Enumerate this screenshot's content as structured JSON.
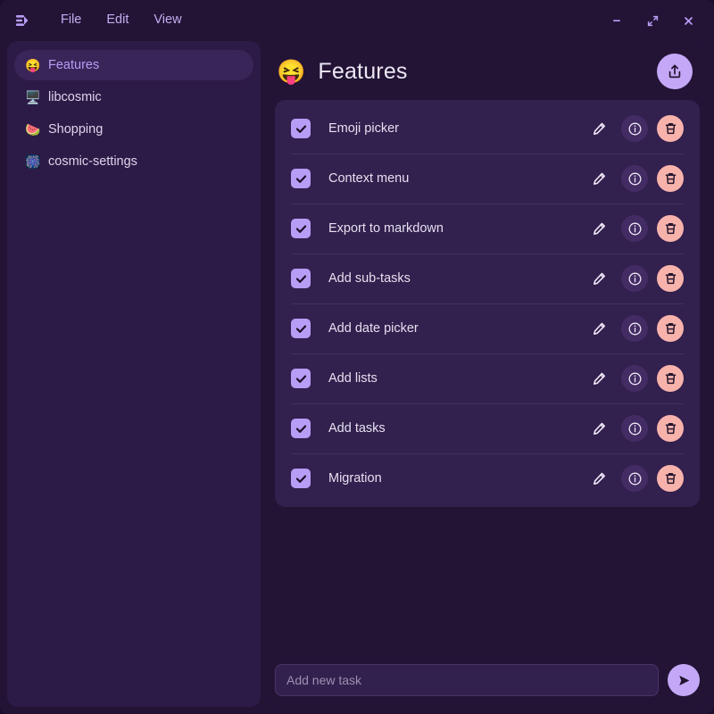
{
  "window": {
    "app_icon": "app-logo-icon",
    "menu": [
      {
        "label": "File",
        "name": "menu-file"
      },
      {
        "label": "Edit",
        "name": "menu-edit"
      },
      {
        "label": "View",
        "name": "menu-view"
      }
    ],
    "controls": {
      "minimize": "minimize-icon",
      "maximize": "maximize-icon",
      "close": "close-icon"
    }
  },
  "colors": {
    "window_bg": "#231436",
    "sidebar_bg": "#2d1b47",
    "sidebar_active_bg": "#3a2559",
    "card_bg": "#32204e",
    "divider": "#42305f",
    "accent_purple": "#b79df5",
    "accent_button": "#c4a8f7",
    "delete_salmon": "#f7b3ab",
    "info_bg": "#432c63",
    "text_primary": "#e6e0f0",
    "text_muted": "#9d91b0"
  },
  "sidebar": {
    "items": [
      {
        "emoji": "😝",
        "label": "Features",
        "active": true
      },
      {
        "emoji": "🖥️",
        "label": "libcosmic",
        "active": false
      },
      {
        "emoji": "🍉",
        "label": "Shopping",
        "active": false
      },
      {
        "emoji": "🎆",
        "label": "cosmic-settings",
        "active": false
      }
    ]
  },
  "main": {
    "header": {
      "emoji": "😝",
      "title": "Features",
      "export_icon": "export-upload-icon"
    },
    "row_icons": {
      "edit": "pencil-icon",
      "info": "info-icon",
      "delete": "trash-icon",
      "checkbox": "checkbox-checked-icon"
    },
    "tasks": [
      {
        "label": "Emoji picker",
        "checked": true
      },
      {
        "label": "Context menu",
        "checked": true
      },
      {
        "label": "Export to markdown",
        "checked": true
      },
      {
        "label": "Add sub-tasks",
        "checked": true
      },
      {
        "label": "Add date picker",
        "checked": true
      },
      {
        "label": "Add lists",
        "checked": true
      },
      {
        "label": "Add tasks",
        "checked": true
      },
      {
        "label": "Migration",
        "checked": true
      }
    ],
    "add_task": {
      "value": "",
      "placeholder": "Add new task",
      "send_icon": "send-paper-plane-icon"
    }
  }
}
